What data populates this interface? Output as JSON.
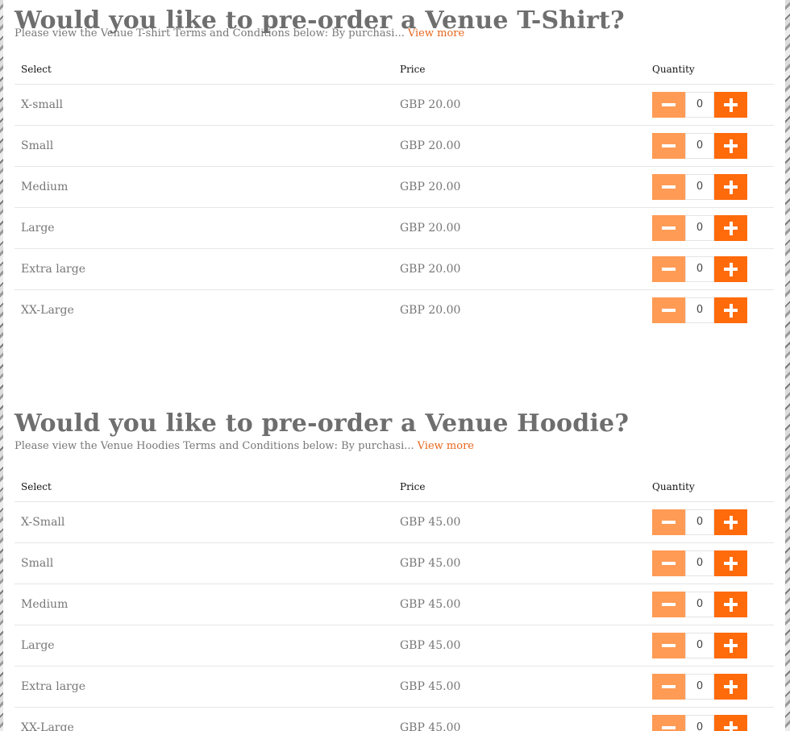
{
  "sections": [
    {
      "title": "Would you like to pre-order a Venue T-Shirt?",
      "terms": "Please view the Venue T-shirt Terms and Conditions below: By purchasi...",
      "view_more": "View more",
      "headers": {
        "select": "Select",
        "price": "Price",
        "quantity": "Quantity"
      },
      "rows": [
        {
          "size": "X-small",
          "price": "GBP 20.00",
          "qty": "0"
        },
        {
          "size": "Small",
          "price": "GBP 20.00",
          "qty": "0"
        },
        {
          "size": "Medium",
          "price": "GBP 20.00",
          "qty": "0"
        },
        {
          "size": "Large",
          "price": "GBP 20.00",
          "qty": "0"
        },
        {
          "size": "Extra large",
          "price": "GBP 20.00",
          "qty": "0"
        },
        {
          "size": "XX-Large",
          "price": "GBP 20.00",
          "qty": "0"
        }
      ]
    },
    {
      "title": "Would you like to pre-order a Venue Hoodie?",
      "terms": "Please view the Venue Hoodies Terms and Conditions below: By purchasi...",
      "view_more": "View more",
      "headers": {
        "select": "Select",
        "price": "Price",
        "quantity": "Quantity"
      },
      "rows": [
        {
          "size": "X-Small",
          "price": "GBP 45.00",
          "qty": "0"
        },
        {
          "size": "Small",
          "price": "GBP 45.00",
          "qty": "0"
        },
        {
          "size": "Medium",
          "price": "GBP 45.00",
          "qty": "0"
        },
        {
          "size": "Large",
          "price": "GBP 45.00",
          "qty": "0"
        },
        {
          "size": "Extra large",
          "price": "GBP 45.00",
          "qty": "0"
        },
        {
          "size": "XX-Large",
          "price": "GBP 45.00",
          "qty": "0"
        }
      ]
    }
  ],
  "icons": {
    "decrease": "minus-icon",
    "increase": "plus-icon"
  },
  "colors": {
    "accent": "#ff6a0a",
    "accent_light": "#ff9b55",
    "link": "#e8661d",
    "title": "#6e6e6e"
  }
}
